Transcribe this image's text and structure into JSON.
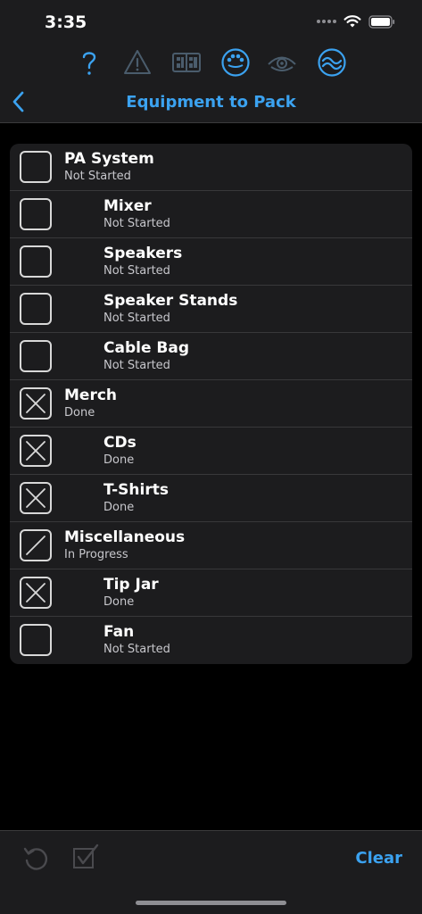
{
  "status": {
    "time": "3:35"
  },
  "toolbar": {
    "icons": [
      "question-mark-icon",
      "warning-icon",
      "keyboard-layout-icon",
      "setlist-circle-icon",
      "eye-icon",
      "sync-circle-icon"
    ]
  },
  "nav": {
    "title": "Equipment to Pack",
    "back_icon": "chevron-left-icon"
  },
  "items": [
    {
      "title": "PA System",
      "status": "Not Started",
      "level": 0,
      "state": "empty"
    },
    {
      "title": "Mixer",
      "status": "Not Started",
      "level": 1,
      "state": "empty"
    },
    {
      "title": "Speakers",
      "status": "Not Started",
      "level": 1,
      "state": "empty"
    },
    {
      "title": "Speaker Stands",
      "status": "Not Started",
      "level": 1,
      "state": "empty"
    },
    {
      "title": "Cable Bag",
      "status": "Not Started",
      "level": 1,
      "state": "empty"
    },
    {
      "title": "Merch",
      "status": "Done",
      "level": 0,
      "state": "done"
    },
    {
      "title": "CDs",
      "status": "Done",
      "level": 1,
      "state": "done"
    },
    {
      "title": "T-Shirts",
      "status": "Done",
      "level": 1,
      "state": "done"
    },
    {
      "title": "Miscellaneous",
      "status": "In Progress",
      "level": 0,
      "state": "progress"
    },
    {
      "title": "Tip Jar",
      "status": "Done",
      "level": 1,
      "state": "done"
    },
    {
      "title": "Fan",
      "status": "Not Started",
      "level": 1,
      "state": "empty"
    }
  ],
  "bottom": {
    "clear_label": "Clear",
    "undo_icon": "undo-icon",
    "check_all_icon": "check-all-icon"
  },
  "colors": {
    "accent": "#3ba2f0",
    "card": "#1c1c1e",
    "background": "#000000"
  }
}
